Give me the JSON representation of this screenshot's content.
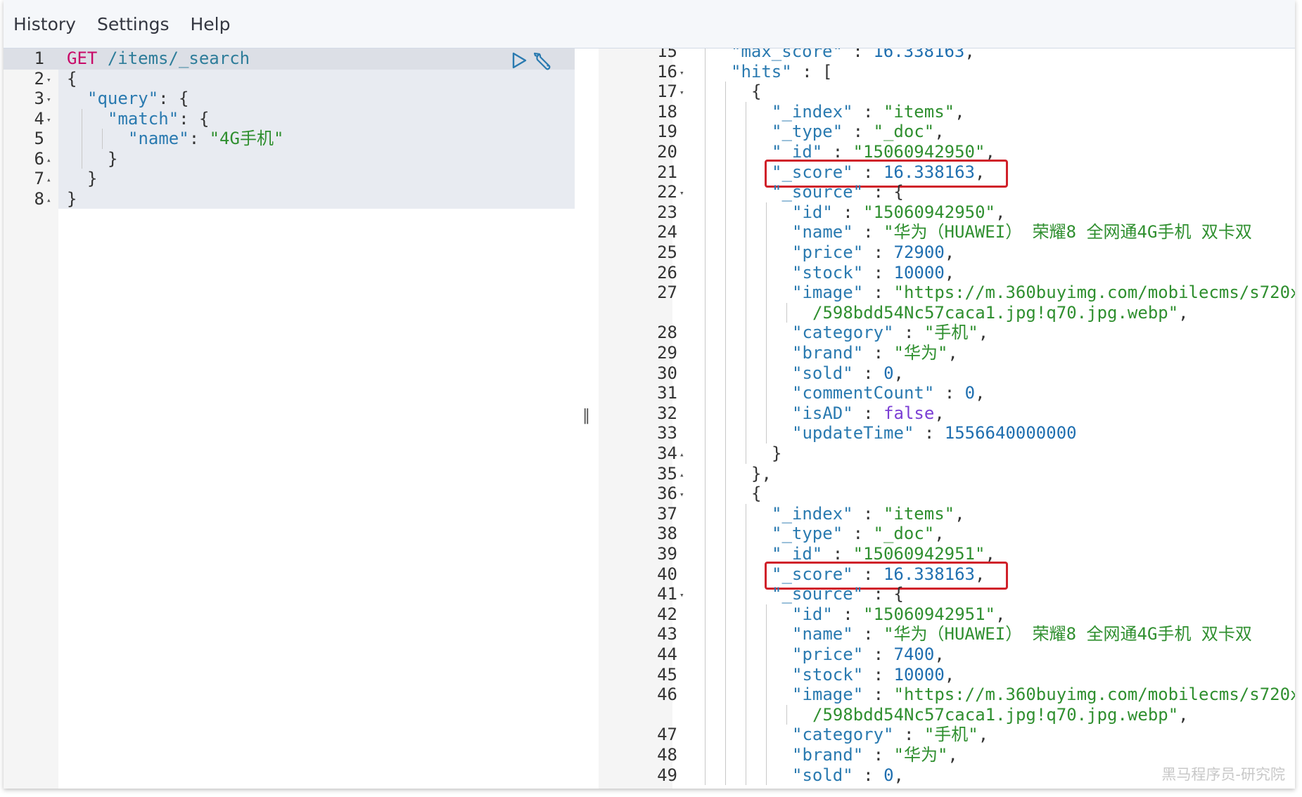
{
  "menu": {
    "items": [
      "History",
      "Settings",
      "Help"
    ]
  },
  "request": {
    "lines": [
      {
        "no": "1",
        "fold": "",
        "indent": 0,
        "tokens": [
          [
            "method",
            "GET"
          ],
          [
            "punc",
            " "
          ],
          [
            "url",
            "/items/_search"
          ]
        ]
      },
      {
        "no": "2",
        "fold": "▾",
        "indent": 0,
        "tokens": [
          [
            "punc",
            "{"
          ]
        ]
      },
      {
        "no": "3",
        "fold": "▾",
        "indent": 1,
        "tokens": [
          [
            "key",
            "\"query\""
          ],
          [
            "punc",
            ": {"
          ]
        ]
      },
      {
        "no": "4",
        "fold": "▾",
        "indent": 2,
        "tokens": [
          [
            "key",
            "\"match\""
          ],
          [
            "punc",
            ": {"
          ]
        ]
      },
      {
        "no": "5",
        "fold": "",
        "indent": 3,
        "tokens": [
          [
            "key",
            "\"name\""
          ],
          [
            "punc",
            ": "
          ],
          [
            "str",
            "\"4G手机\""
          ]
        ]
      },
      {
        "no": "6",
        "fold": "▴",
        "indent": 2,
        "tokens": [
          [
            "punc",
            "}"
          ]
        ]
      },
      {
        "no": "7",
        "fold": "▴",
        "indent": 1,
        "tokens": [
          [
            "punc",
            "}"
          ]
        ]
      },
      {
        "no": "8",
        "fold": "▴",
        "indent": 0,
        "tokens": [
          [
            "punc",
            "}"
          ]
        ]
      }
    ]
  },
  "icons": {
    "run": "play-icon",
    "wrench": "wrench-icon"
  },
  "divider": {
    "handle": "‖"
  },
  "response": {
    "lines": [
      {
        "no": "15",
        "fold": "",
        "indent": 2,
        "tokens": [
          [
            "key",
            "\"max_score\""
          ],
          [
            "punc",
            " : "
          ],
          [
            "num",
            "16.338163"
          ],
          [
            "punc",
            ","
          ]
        ]
      },
      {
        "no": "16",
        "fold": "▾",
        "indent": 2,
        "tokens": [
          [
            "key",
            "\"hits\""
          ],
          [
            "punc",
            " : ["
          ]
        ]
      },
      {
        "no": "17",
        "fold": "▾",
        "indent": 3,
        "tokens": [
          [
            "punc",
            "{"
          ]
        ]
      },
      {
        "no": "18",
        "fold": "",
        "indent": 4,
        "tokens": [
          [
            "key",
            "\"_index\""
          ],
          [
            "punc",
            " : "
          ],
          [
            "str",
            "\"items\""
          ],
          [
            "punc",
            ","
          ]
        ]
      },
      {
        "no": "19",
        "fold": "",
        "indent": 4,
        "tokens": [
          [
            "key",
            "\"_type\""
          ],
          [
            "punc",
            " : "
          ],
          [
            "str",
            "\"_doc\""
          ],
          [
            "punc",
            ","
          ]
        ]
      },
      {
        "no": "20",
        "fold": "",
        "indent": 4,
        "tokens": [
          [
            "key",
            "\"_id\""
          ],
          [
            "punc",
            " : "
          ],
          [
            "str",
            "\"15060942950\""
          ],
          [
            "punc",
            ","
          ]
        ]
      },
      {
        "no": "21",
        "fold": "",
        "indent": 4,
        "highlight": true,
        "tokens": [
          [
            "key",
            "\"_score\""
          ],
          [
            "punc",
            " : "
          ],
          [
            "num",
            "16.338163"
          ],
          [
            "punc",
            ","
          ]
        ]
      },
      {
        "no": "22",
        "fold": "▾",
        "indent": 4,
        "tokens": [
          [
            "key",
            "\"_source\""
          ],
          [
            "punc",
            " : {"
          ]
        ]
      },
      {
        "no": "23",
        "fold": "",
        "indent": 5,
        "tokens": [
          [
            "key",
            "\"id\""
          ],
          [
            "punc",
            " : "
          ],
          [
            "str",
            "\"15060942950\""
          ],
          [
            "punc",
            ","
          ]
        ]
      },
      {
        "no": "24",
        "fold": "",
        "indent": 5,
        "tokens": [
          [
            "key",
            "\"name\""
          ],
          [
            "punc",
            " : "
          ],
          [
            "str",
            "\"华为（HUAWEI） 荣耀8 全网通4G手机 双卡双"
          ]
        ]
      },
      {
        "no": "25",
        "fold": "",
        "indent": 5,
        "tokens": [
          [
            "key",
            "\"price\""
          ],
          [
            "punc",
            " : "
          ],
          [
            "num",
            "72900"
          ],
          [
            "punc",
            ","
          ]
        ]
      },
      {
        "no": "26",
        "fold": "",
        "indent": 5,
        "tokens": [
          [
            "key",
            "\"stock\""
          ],
          [
            "punc",
            " : "
          ],
          [
            "num",
            "10000"
          ],
          [
            "punc",
            ","
          ]
        ]
      },
      {
        "no": "27",
        "fold": "",
        "indent": 5,
        "tokens": [
          [
            "key",
            "\"image\""
          ],
          [
            "punc",
            " : "
          ],
          [
            "str",
            "\"https://m.360buyimg.com/mobilecms/s720x"
          ]
        ]
      },
      {
        "no": "",
        "fold": "",
        "indent": 6,
        "tokens": [
          [
            "str",
            "/598bdd54Nc57caca1.jpg!q70.jpg.webp\""
          ],
          [
            "punc",
            ","
          ]
        ]
      },
      {
        "no": "28",
        "fold": "",
        "indent": 5,
        "tokens": [
          [
            "key",
            "\"category\""
          ],
          [
            "punc",
            " : "
          ],
          [
            "str",
            "\"手机\""
          ],
          [
            "punc",
            ","
          ]
        ]
      },
      {
        "no": "29",
        "fold": "",
        "indent": 5,
        "tokens": [
          [
            "key",
            "\"brand\""
          ],
          [
            "punc",
            " : "
          ],
          [
            "str",
            "\"华为\""
          ],
          [
            "punc",
            ","
          ]
        ]
      },
      {
        "no": "30",
        "fold": "",
        "indent": 5,
        "tokens": [
          [
            "key",
            "\"sold\""
          ],
          [
            "punc",
            " : "
          ],
          [
            "num",
            "0"
          ],
          [
            "punc",
            ","
          ]
        ]
      },
      {
        "no": "31",
        "fold": "",
        "indent": 5,
        "tokens": [
          [
            "key",
            "\"commentCount\""
          ],
          [
            "punc",
            " : "
          ],
          [
            "num",
            "0"
          ],
          [
            "punc",
            ","
          ]
        ]
      },
      {
        "no": "32",
        "fold": "",
        "indent": 5,
        "tokens": [
          [
            "key",
            "\"isAD\""
          ],
          [
            "punc",
            " : "
          ],
          [
            "bool",
            "false"
          ],
          [
            "punc",
            ","
          ]
        ]
      },
      {
        "no": "33",
        "fold": "",
        "indent": 5,
        "tokens": [
          [
            "key",
            "\"updateTime\""
          ],
          [
            "punc",
            " : "
          ],
          [
            "num",
            "1556640000000"
          ]
        ]
      },
      {
        "no": "34",
        "fold": "▴",
        "indent": 4,
        "tokens": [
          [
            "punc",
            "}"
          ]
        ]
      },
      {
        "no": "35",
        "fold": "▴",
        "indent": 3,
        "tokens": [
          [
            "punc",
            "},"
          ]
        ]
      },
      {
        "no": "36",
        "fold": "▾",
        "indent": 3,
        "tokens": [
          [
            "punc",
            "{"
          ]
        ]
      },
      {
        "no": "37",
        "fold": "",
        "indent": 4,
        "tokens": [
          [
            "key",
            "\"_index\""
          ],
          [
            "punc",
            " : "
          ],
          [
            "str",
            "\"items\""
          ],
          [
            "punc",
            ","
          ]
        ]
      },
      {
        "no": "38",
        "fold": "",
        "indent": 4,
        "tokens": [
          [
            "key",
            "\"_type\""
          ],
          [
            "punc",
            " : "
          ],
          [
            "str",
            "\"_doc\""
          ],
          [
            "punc",
            ","
          ]
        ]
      },
      {
        "no": "39",
        "fold": "",
        "indent": 4,
        "tokens": [
          [
            "key",
            "\"_id\""
          ],
          [
            "punc",
            " : "
          ],
          [
            "str",
            "\"15060942951\""
          ],
          [
            "punc",
            ","
          ]
        ]
      },
      {
        "no": "40",
        "fold": "",
        "indent": 4,
        "highlight": true,
        "tokens": [
          [
            "key",
            "\"_score\""
          ],
          [
            "punc",
            " : "
          ],
          [
            "num",
            "16.338163"
          ],
          [
            "punc",
            ","
          ]
        ]
      },
      {
        "no": "41",
        "fold": "▾",
        "indent": 4,
        "tokens": [
          [
            "key",
            "\"_source\""
          ],
          [
            "punc",
            " : {"
          ]
        ]
      },
      {
        "no": "42",
        "fold": "",
        "indent": 5,
        "tokens": [
          [
            "key",
            "\"id\""
          ],
          [
            "punc",
            " : "
          ],
          [
            "str",
            "\"15060942951\""
          ],
          [
            "punc",
            ","
          ]
        ]
      },
      {
        "no": "43",
        "fold": "",
        "indent": 5,
        "tokens": [
          [
            "key",
            "\"name\""
          ],
          [
            "punc",
            " : "
          ],
          [
            "str",
            "\"华为（HUAWEI） 荣耀8 全网通4G手机 双卡双"
          ]
        ]
      },
      {
        "no": "44",
        "fold": "",
        "indent": 5,
        "tokens": [
          [
            "key",
            "\"price\""
          ],
          [
            "punc",
            " : "
          ],
          [
            "num",
            "7400"
          ],
          [
            "punc",
            ","
          ]
        ]
      },
      {
        "no": "45",
        "fold": "",
        "indent": 5,
        "tokens": [
          [
            "key",
            "\"stock\""
          ],
          [
            "punc",
            " : "
          ],
          [
            "num",
            "10000"
          ],
          [
            "punc",
            ","
          ]
        ]
      },
      {
        "no": "46",
        "fold": "",
        "indent": 5,
        "tokens": [
          [
            "key",
            "\"image\""
          ],
          [
            "punc",
            " : "
          ],
          [
            "str",
            "\"https://m.360buyimg.com/mobilecms/s720x"
          ]
        ]
      },
      {
        "no": "",
        "fold": "",
        "indent": 6,
        "tokens": [
          [
            "str",
            "/598bdd54Nc57caca1.jpg!q70.jpg.webp\""
          ],
          [
            "punc",
            ","
          ]
        ]
      },
      {
        "no": "47",
        "fold": "",
        "indent": 5,
        "tokens": [
          [
            "key",
            "\"category\""
          ],
          [
            "punc",
            " : "
          ],
          [
            "str",
            "\"手机\""
          ],
          [
            "punc",
            ","
          ]
        ]
      },
      {
        "no": "48",
        "fold": "",
        "indent": 5,
        "tokens": [
          [
            "key",
            "\"brand\""
          ],
          [
            "punc",
            " : "
          ],
          [
            "str",
            "\"华为\""
          ],
          [
            "punc",
            ","
          ]
        ]
      },
      {
        "no": "49",
        "fold": "",
        "indent": 5,
        "tokens": [
          [
            "key",
            "\"sold\""
          ],
          [
            "punc",
            " : "
          ],
          [
            "num",
            "0"
          ],
          [
            "punc",
            ","
          ]
        ]
      }
    ]
  },
  "watermark": "黑马程序员-研究院",
  "colors": {
    "highlight_box": "#d0202a",
    "method": "#c80a68",
    "string": "#2f8f2f",
    "key": "#2a7ab0"
  }
}
